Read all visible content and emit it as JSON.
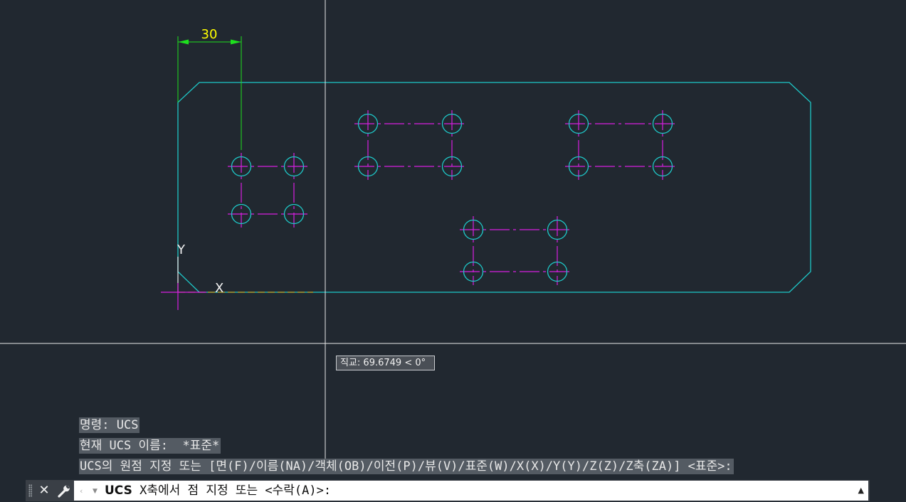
{
  "drawing": {
    "dimension_text": "30",
    "ucs_x_label": "X",
    "ucs_y_label": "Y"
  },
  "tooltip": {
    "text": "직교: 69.6749 < 0°"
  },
  "command_history": [
    "명령: UCS",
    "현재 UCS 이름:  *표준*",
    "UCS의 원점 지정 또는 [면(F)/이름(NA)/객체(OB)/이전(P)/뷰(V)/표준(W)/X(X)/Y(Y)/Z(Z)/Z축(ZA)] <표준>:"
  ],
  "command_line": {
    "command_name": "UCS",
    "prompt": " X축에서 점 지정 또는 <수락(A)>:"
  },
  "icons": {
    "close": "close-icon",
    "customize": "wrench-icon",
    "recent": "recent-commands-icon",
    "expand": "expand-history-icon"
  },
  "colors": {
    "background": "#212830",
    "geometry": "#1ec8c8",
    "centerline": "#d81ee0",
    "dimension": "#1ee01e",
    "dimension_text": "#ffff00",
    "crosshair": "#e8e8e8"
  }
}
